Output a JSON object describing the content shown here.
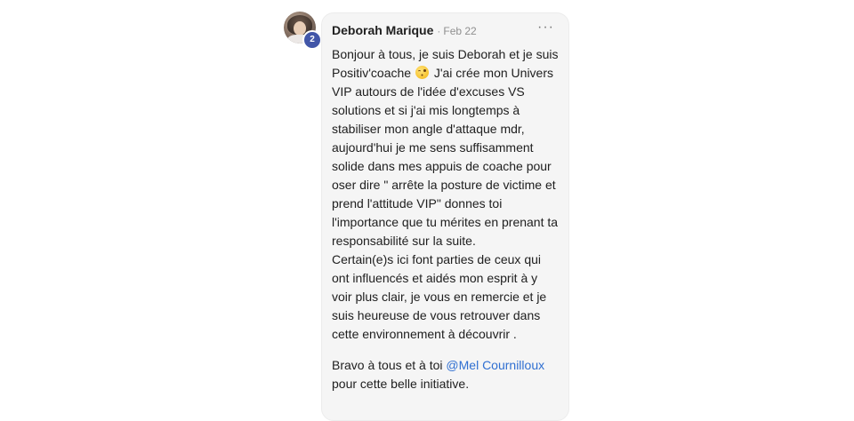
{
  "post": {
    "author": "Deborah Marique",
    "separator": "·",
    "date": "Feb 22",
    "level_badge": "2",
    "more_icon": "more-horizontal-icon",
    "more_label": "···",
    "emoji": "winking-face",
    "body_lines": [
      "Bonjour à tous, je suis Deborah et je suis",
      "Positiv'coache",
      "J'ai crée mon Univers",
      "VIP autours de l'idée d'excuses VS",
      "solutions et si j'ai mis longtemps à",
      "stabiliser mon angle d'attaque mdr,",
      "aujourd'hui je me sens suffisamment",
      "solide dans mes appuis de coache pour",
      "oser dire \" arrête la posture de victime et",
      "prend l'attitude VIP\" donnes toi",
      "l'importance que tu mérites en prenant ta",
      "responsabilité sur la suite.",
      "Certain(e)s ici font parties de ceux qui",
      "ont influencés et aidés mon esprit à y",
      "voir plus clair, je vous en remercie et je",
      "suis heureuse de vous retrouver dans",
      "cette environnement à découvrir ."
    ],
    "closing_prefix": "Bravo à tous et à toi ",
    "mention": "@Mel Cournilloux",
    "closing_suffix": "pour cette belle initiative."
  },
  "colors": {
    "bubble_bg": "#f5f5f5",
    "mention": "#2f6fd1",
    "badge": "#4256a8"
  }
}
